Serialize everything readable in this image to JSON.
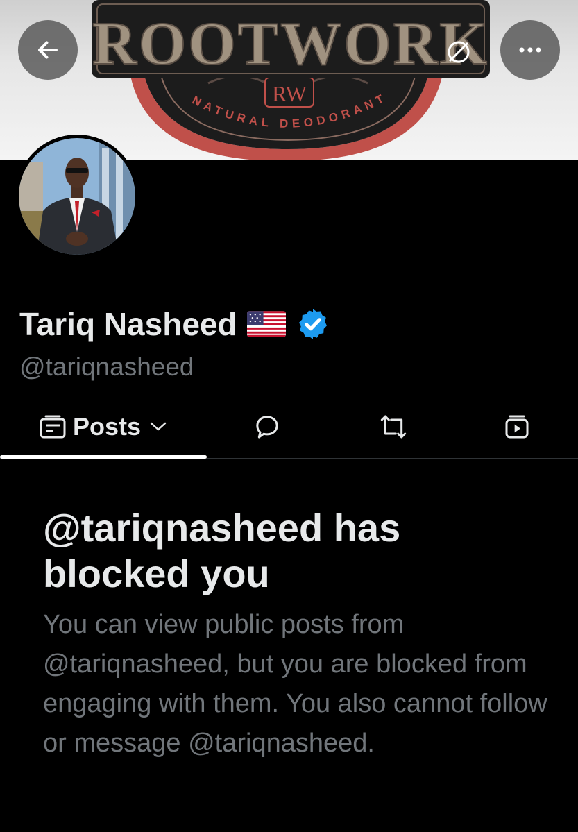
{
  "banner": {
    "brand_name": "ROOTWORK",
    "monogram": "RW",
    "tagline": "NATURAL DEODORANT",
    "colors": {
      "accent": "#c0504a",
      "dark": "#1c1c1c",
      "letters": "#a09280"
    }
  },
  "header": {
    "back_icon": "arrow-left-icon",
    "more_icon": "more-horizontal-icon"
  },
  "profile": {
    "display_name": "Tariq Nasheed",
    "flag": "us-flag-icon",
    "verified_icon": "verified-badge-icon",
    "verified_color": "#1d9bf0",
    "handle": "@tariqnasheed"
  },
  "tabs": [
    {
      "label": "Posts",
      "icon": "posts-icon",
      "dropdown_icon": "chevron-down-icon",
      "active": true
    },
    {
      "label": "",
      "icon": "reply-bubble-icon"
    },
    {
      "label": "",
      "icon": "repost-icon"
    },
    {
      "label": "",
      "icon": "media-icon"
    }
  ],
  "blocked": {
    "title": "@tariqnasheed has blocked you",
    "message": "You can view public posts from @tariqnasheed, but you are blocked from engaging with them. You also cannot follow or message @tariqnasheed."
  }
}
